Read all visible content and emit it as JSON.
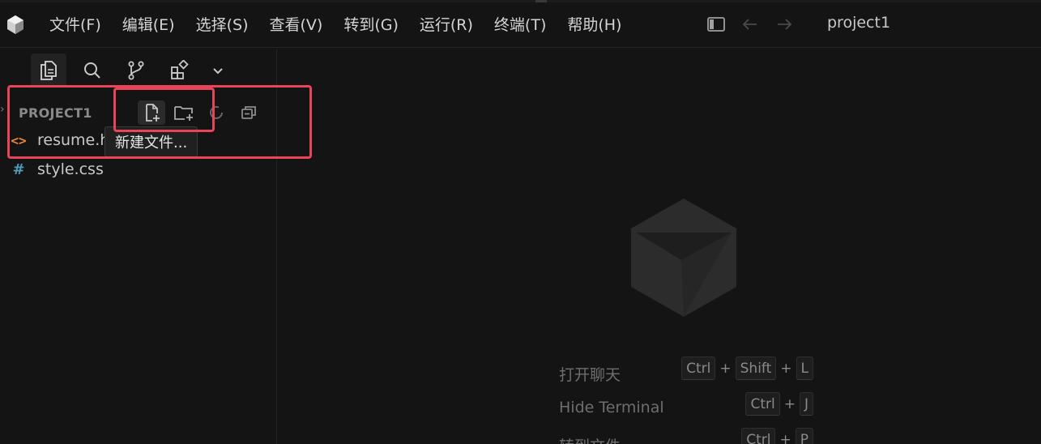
{
  "menu": {
    "items": [
      "文件(F)",
      "编辑(E)",
      "选择(S)",
      "查看(V)",
      "转到(G)",
      "运行(R)",
      "终端(T)",
      "帮助(H)"
    ]
  },
  "window": {
    "title": "project1"
  },
  "explorer": {
    "section_title": "PROJECT1",
    "files": [
      {
        "name": "resume.h",
        "icon": "html-file-icon",
        "icon_glyph": "<>"
      },
      {
        "name": "style.css",
        "icon": "css-file-icon",
        "icon_glyph": "#"
      }
    ],
    "tooltip": "新建文件..."
  },
  "editor": {
    "shortcuts": [
      {
        "label": "打开聊天",
        "keys": [
          "Ctrl",
          "Shift",
          "L"
        ]
      },
      {
        "label": "Hide Terminal",
        "keys": [
          "Ctrl",
          "J"
        ]
      },
      {
        "label": "转到文件",
        "keys": [
          "Ctrl",
          "P"
        ]
      }
    ]
  },
  "colors": {
    "background": "#141414",
    "highlight": "#e8445a",
    "html_icon": "#e8843a",
    "css_icon": "#519aba"
  }
}
